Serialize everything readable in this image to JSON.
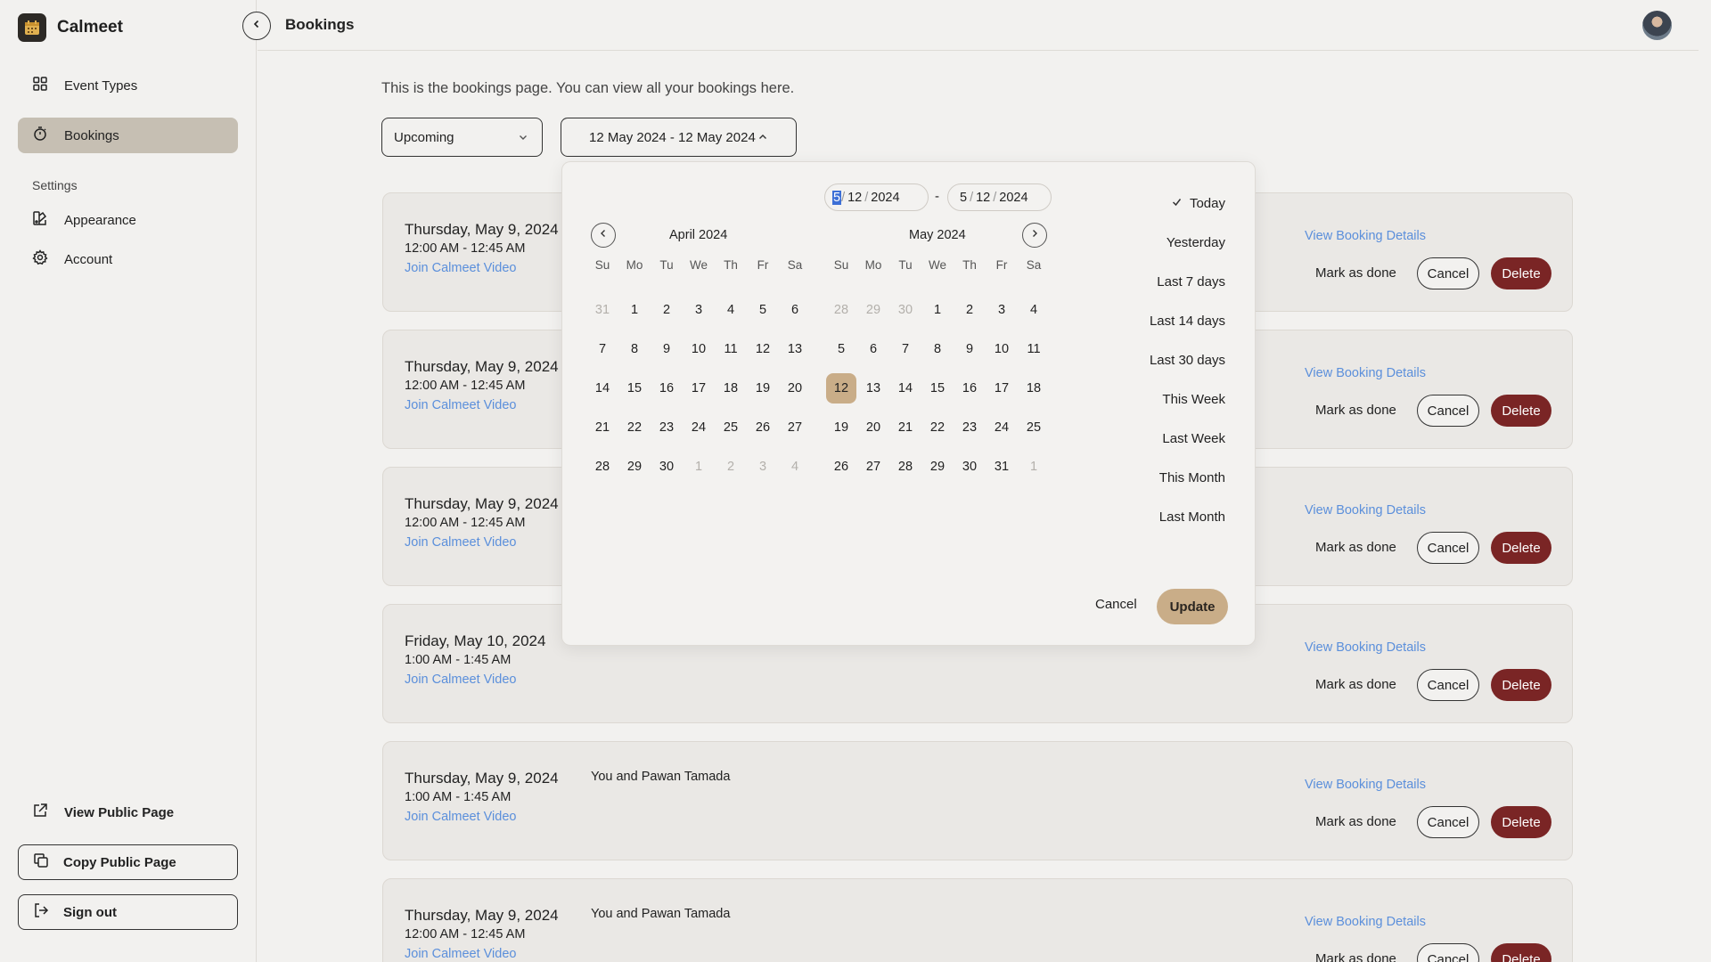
{
  "app": {
    "name": "Calmeet"
  },
  "sidebar": {
    "items": [
      {
        "label": "Event Types",
        "icon": "grid-icon"
      },
      {
        "label": "Bookings",
        "icon": "stopwatch-icon",
        "active": true
      }
    ],
    "settings_label": "Settings",
    "settings_items": [
      {
        "label": "Appearance",
        "icon": "palette-icon"
      },
      {
        "label": "Account",
        "icon": "gear-icon"
      }
    ],
    "view_public_page": "View Public Page",
    "copy_public_page": "Copy Public Page",
    "sign_out": "Sign out"
  },
  "header": {
    "title": "Bookings"
  },
  "main": {
    "intro": "This is the bookings page. You can view all your bookings here.",
    "filter_select": "Upcoming",
    "date_range": "12 May 2024 - 12 May 2024"
  },
  "bookings": [
    {
      "date": "Thursday, May 9, 2024",
      "time": "12:00 AM - 12:45 AM",
      "join": "Join Calmeet Video",
      "attendees": "",
      "details": "View Booking Details",
      "done": "Mark as done",
      "cancel": "Cancel",
      "delete": "Delete"
    },
    {
      "date": "Thursday, May 9, 2024",
      "time": "12:00 AM - 12:45 AM",
      "join": "Join Calmeet Video",
      "attendees": "",
      "details": "View Booking Details",
      "done": "Mark as done",
      "cancel": "Cancel",
      "delete": "Delete"
    },
    {
      "date": "Thursday, May 9, 2024",
      "time": "12:00 AM - 12:45 AM",
      "join": "Join Calmeet Video",
      "attendees": "",
      "details": "View Booking Details",
      "done": "Mark as done",
      "cancel": "Cancel",
      "delete": "Delete"
    },
    {
      "date": "Friday, May 10, 2024",
      "time": "1:00 AM - 1:45 AM",
      "join": "Join Calmeet Video",
      "attendees": "",
      "details": "View Booking Details",
      "done": "Mark as done",
      "cancel": "Cancel",
      "delete": "Delete"
    },
    {
      "date": "Thursday, May 9, 2024",
      "time": "1:00 AM - 1:45 AM",
      "join": "Join Calmeet Video",
      "attendees": "You and Pawan Tamada",
      "details": "View Booking Details",
      "done": "Mark as done",
      "cancel": "Cancel",
      "delete": "Delete"
    },
    {
      "date": "Thursday, May 9, 2024",
      "time": "12:00 AM - 12:45 AM",
      "join": "Join Calmeet Video",
      "attendees": "You and Pawan Tamada",
      "details": "View Booking Details",
      "done": "Mark as done",
      "cancel": "Cancel",
      "delete": "Delete"
    }
  ],
  "picker": {
    "start": {
      "month": "5",
      "day": "12",
      "year": "2024"
    },
    "end": {
      "month": "5",
      "day": "12",
      "year": "2024"
    },
    "dash": "-",
    "weekdays": [
      "Su",
      "Mo",
      "Tu",
      "We",
      "Th",
      "Fr",
      "Sa"
    ],
    "months": [
      {
        "title": "April 2024",
        "days": [
          {
            "d": "31",
            "muted": true
          },
          {
            "d": "1"
          },
          {
            "d": "2"
          },
          {
            "d": "3"
          },
          {
            "d": "4"
          },
          {
            "d": "5"
          },
          {
            "d": "6"
          },
          {
            "d": "7"
          },
          {
            "d": "8"
          },
          {
            "d": "9"
          },
          {
            "d": "10"
          },
          {
            "d": "11"
          },
          {
            "d": "12"
          },
          {
            "d": "13"
          },
          {
            "d": "14"
          },
          {
            "d": "15"
          },
          {
            "d": "16"
          },
          {
            "d": "17"
          },
          {
            "d": "18"
          },
          {
            "d": "19"
          },
          {
            "d": "20"
          },
          {
            "d": "21"
          },
          {
            "d": "22"
          },
          {
            "d": "23"
          },
          {
            "d": "24"
          },
          {
            "d": "25"
          },
          {
            "d": "26"
          },
          {
            "d": "27"
          },
          {
            "d": "28"
          },
          {
            "d": "29"
          },
          {
            "d": "30"
          },
          {
            "d": "1",
            "muted": true
          },
          {
            "d": "2",
            "muted": true
          },
          {
            "d": "3",
            "muted": true
          },
          {
            "d": "4",
            "muted": true
          }
        ]
      },
      {
        "title": "May 2024",
        "days": [
          {
            "d": "28",
            "muted": true
          },
          {
            "d": "29",
            "muted": true
          },
          {
            "d": "30",
            "muted": true
          },
          {
            "d": "1"
          },
          {
            "d": "2"
          },
          {
            "d": "3"
          },
          {
            "d": "4"
          },
          {
            "d": "5"
          },
          {
            "d": "6"
          },
          {
            "d": "7"
          },
          {
            "d": "8"
          },
          {
            "d": "9"
          },
          {
            "d": "10"
          },
          {
            "d": "11"
          },
          {
            "d": "12",
            "selected": true
          },
          {
            "d": "13"
          },
          {
            "d": "14"
          },
          {
            "d": "15"
          },
          {
            "d": "16"
          },
          {
            "d": "17"
          },
          {
            "d": "18"
          },
          {
            "d": "19"
          },
          {
            "d": "20"
          },
          {
            "d": "21"
          },
          {
            "d": "22"
          },
          {
            "d": "23"
          },
          {
            "d": "24"
          },
          {
            "d": "25"
          },
          {
            "d": "26"
          },
          {
            "d": "27"
          },
          {
            "d": "28"
          },
          {
            "d": "29"
          },
          {
            "d": "30"
          },
          {
            "d": "31"
          },
          {
            "d": "1",
            "muted": true
          }
        ]
      }
    ],
    "presets": [
      {
        "label": "Today",
        "checked": true
      },
      {
        "label": "Yesterday"
      },
      {
        "label": "Last 7 days"
      },
      {
        "label": "Last 14 days"
      },
      {
        "label": "Last 30 days"
      },
      {
        "label": "This Week"
      },
      {
        "label": "Last Week"
      },
      {
        "label": "This Month"
      },
      {
        "label": "Last Month"
      }
    ],
    "cancel": "Cancel",
    "update": "Update"
  },
  "colors": {
    "accent": "#c9ad88",
    "delete": "#7a2525",
    "link": "#5b8fdb",
    "active_nav": "#c6bfb3"
  }
}
